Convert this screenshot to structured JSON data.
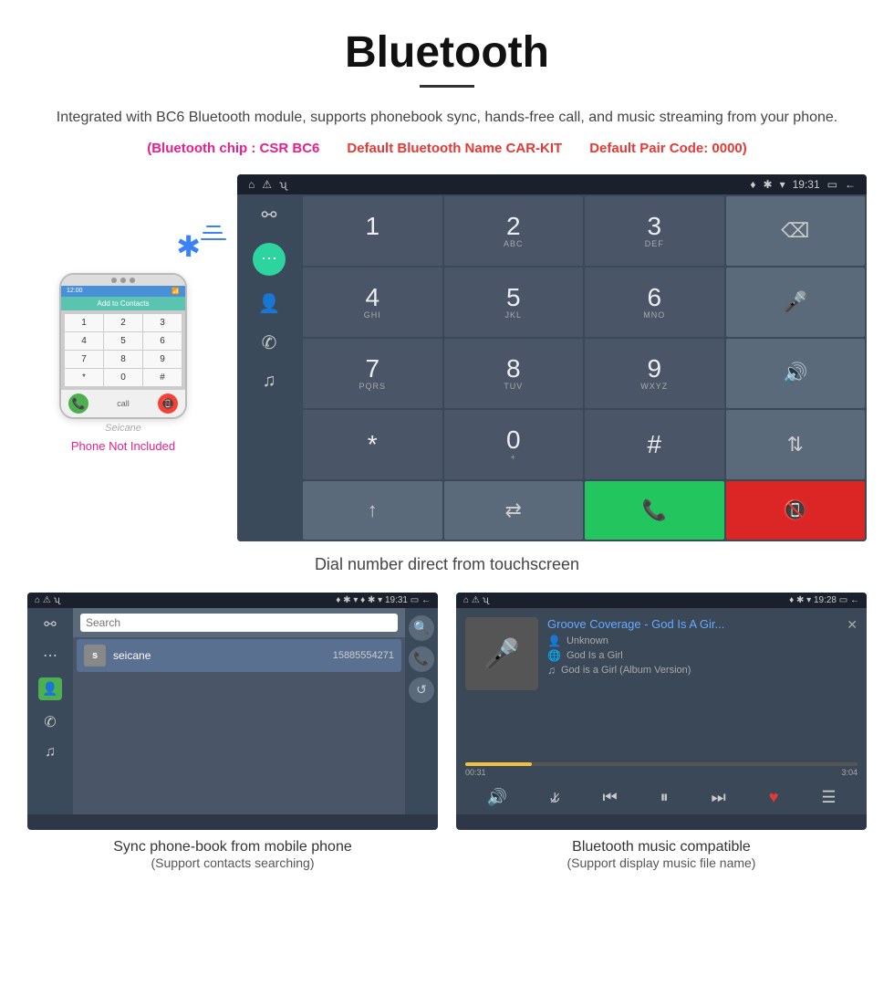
{
  "header": {
    "title": "Bluetooth",
    "description": "Integrated with BC6 Bluetooth module, supports phonebook sync, hands-free call, and music streaming from your phone.",
    "spec1": "(Bluetooth chip : CSR BC6",
    "spec2": "Default Bluetooth Name CAR-KIT",
    "spec3": "Default Pair Code: 0000)"
  },
  "main_screen": {
    "status_left": "⌂  ⚠  ψ",
    "status_right": "♦ ✱ ▾  19:31  ▭  ←",
    "dial_keys": [
      {
        "num": "1",
        "sub": ""
      },
      {
        "num": "2",
        "sub": "ABC"
      },
      {
        "num": "3",
        "sub": "DEF"
      },
      {
        "num": "⌫",
        "sub": "",
        "type": "action"
      },
      {
        "num": "4",
        "sub": "GHI"
      },
      {
        "num": "5",
        "sub": "JKL"
      },
      {
        "num": "6",
        "sub": "MNO"
      },
      {
        "num": "🎤",
        "sub": "",
        "type": "icon"
      },
      {
        "num": "7",
        "sub": "PQRS"
      },
      {
        "num": "8",
        "sub": "TUV"
      },
      {
        "num": "9",
        "sub": "WXYZ"
      },
      {
        "num": "🔊",
        "sub": "",
        "type": "icon"
      },
      {
        "num": "*",
        "sub": ""
      },
      {
        "num": "0",
        "sub": "+"
      },
      {
        "num": "#",
        "sub": ""
      },
      {
        "num": "⇅",
        "sub": "",
        "type": "action"
      },
      {
        "num": "⬆",
        "sub": "",
        "type": "action"
      },
      {
        "num": "⇄",
        "sub": "",
        "type": "action"
      },
      {
        "num": "📞",
        "sub": "",
        "type": "green"
      },
      {
        "num": "📵",
        "sub": "",
        "type": "red"
      }
    ],
    "caption": "Dial number direct from touchscreen"
  },
  "phone_mockup": {
    "not_included": "Phone Not Included",
    "brand": "Seicane",
    "add_contacts": "Add to Contacts",
    "keys": [
      "1",
      "2",
      "3",
      "4",
      "5",
      "6",
      "7",
      "8",
      "9",
      "*",
      "0",
      "#"
    ]
  },
  "bottom_left": {
    "status_left": "⌂  ⚠  ψ",
    "status_right": "♦ ✱ ▾  19:31  ▭  ←",
    "search_placeholder": "Search",
    "contact_initial": "s",
    "contact_name": "seicane",
    "contact_number": "15885554271",
    "caption1": "Sync phone-book from mobile phone",
    "caption2": "(Support contacts searching)"
  },
  "bottom_right": {
    "status_left": "⌂  ⚠  ψ",
    "status_right": "♦ ✱ ▾  19:28  ▭  ←",
    "song_title": "Groove Coverage - God Is A Gir...",
    "artist1_label": "Unknown",
    "artist2_label": "God Is a Girl",
    "track_label": "God is a Girl (Album Version)",
    "time_current": "00:31",
    "time_total": "3:04",
    "caption1": "Bluetooth music compatible",
    "caption2": "(Support display music file name)"
  }
}
